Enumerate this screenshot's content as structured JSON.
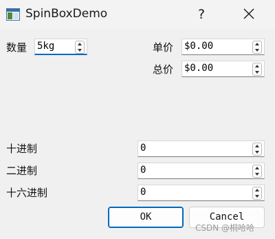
{
  "window": {
    "title": "SpinBoxDemo",
    "help_label": "?",
    "icon": "app-window-icon",
    "close_icon": "close-x-icon"
  },
  "quantity": {
    "label": "数量",
    "value": "5kg"
  },
  "unit_price": {
    "label": "单价",
    "value": "$0.00"
  },
  "total_price": {
    "label": "总价",
    "value": "$0.00"
  },
  "decimal": {
    "label": "十进制",
    "value": "0"
  },
  "binary": {
    "label": "二进制",
    "value": "0"
  },
  "hexadecimal": {
    "label": "十六进制",
    "value": "0"
  },
  "buttons": {
    "ok": "OK",
    "cancel": "Cancel"
  },
  "watermark": "CSDN @桐哈哈",
  "colors": {
    "accent": "#0067c0",
    "background": "#f0f0f0"
  }
}
